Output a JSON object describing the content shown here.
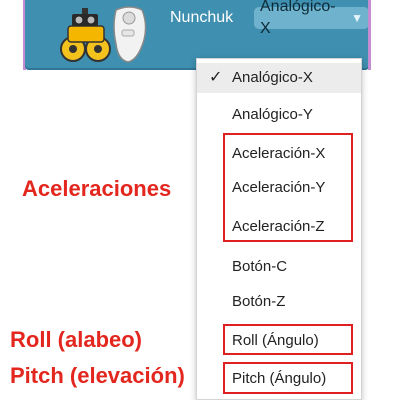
{
  "block": {
    "label": "Nunchuk",
    "dropdown_value": "Analógico-X",
    "dropdown_arrow": "▼",
    "color": "#3f8fb0",
    "icons": [
      "robot-car-icon",
      "nunchuk-controller-icon"
    ]
  },
  "menu": {
    "check_mark": "✓",
    "items": [
      {
        "label": "Analógico-X",
        "selected": true
      },
      {
        "label": "Analógico-Y"
      },
      {
        "label": "Aceleración-X"
      },
      {
        "label": "Aceleración-Y"
      },
      {
        "label": "Aceleración-Z"
      },
      {
        "label": "Botón-C"
      },
      {
        "label": "Botón-Z"
      },
      {
        "label": "Roll (Ángulo)"
      },
      {
        "label": "Pitch (Ángulo)"
      }
    ]
  },
  "annotations": {
    "accelerations": "Aceleraciones",
    "roll": "Roll (alabeo)",
    "pitch": "Pitch (elevación)",
    "color": "#e3261e"
  }
}
